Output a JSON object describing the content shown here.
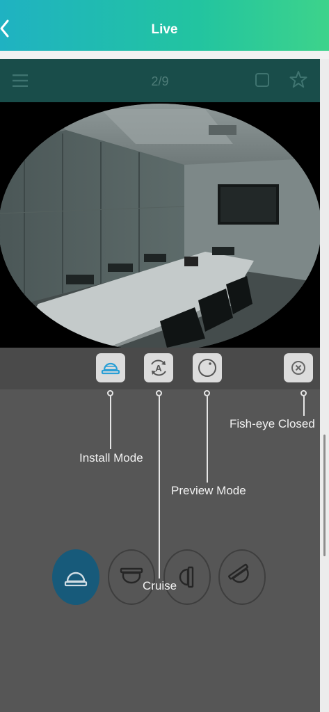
{
  "header": {
    "title": "Live"
  },
  "toolbar": {
    "page_indicator": "2/9"
  },
  "colors": {
    "header_gradient_start": "#1fb2c2",
    "header_gradient_end": "#3dd38b",
    "toolbar_bg": "#194d4a",
    "panel_bg": "#565656",
    "active_mode": "#175a7a",
    "install_icon_accent": "#2a9fd6"
  },
  "icons": {
    "back": "chevron-left-icon",
    "menu": "hamburger-icon",
    "layout": "square-icon",
    "favorite": "star-icon",
    "install_mode": "ceiling-dome-icon",
    "cruise": "auto-cruise-icon",
    "preview_mode": "fisheye-circle-icon",
    "fisheye_close": "close-circle-icon"
  },
  "callouts": {
    "install_mode": "Install Mode",
    "cruise": "Cruise",
    "preview_mode": "Preview Mode",
    "fisheye_closed": "Fish-eye Closed"
  },
  "install_modes": [
    {
      "name": "ceiling",
      "active": true
    },
    {
      "name": "desktop",
      "active": false
    },
    {
      "name": "wall",
      "active": false
    },
    {
      "name": "slanted",
      "active": false
    }
  ]
}
